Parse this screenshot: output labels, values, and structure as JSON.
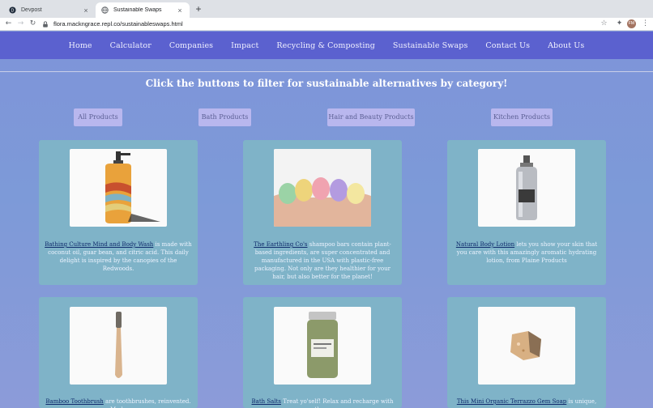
{
  "browser": {
    "tabs": [
      {
        "title": "Devpost",
        "active": false
      },
      {
        "title": "Sustainable Swaps",
        "active": true
      }
    ],
    "new_tab": "+",
    "close": "×",
    "url": "flora.mackngrace.repl.co/sustainableswaps.html",
    "avatar_initials": "FM"
  },
  "nav": {
    "links": [
      "Home",
      "Calculator",
      "Companies",
      "Impact",
      "Recycling & Composting",
      "Sustainable Swaps",
      "Contact Us",
      "About Us"
    ]
  },
  "headline": "Click the buttons to filter for sustainable alternatives by category!",
  "filters": [
    "All Products",
    "Bath Products",
    "Hair and Beauty Products",
    "Kitchen Products"
  ],
  "cards": [
    {
      "link": "Bathing Culture Mind and Body Wash",
      "text": " is made with coconut oil, guar bean, and citric acid. This daily delight is inspired by the canopies of the Redwoods.",
      "image": "soap-bottle"
    },
    {
      "link": "The Earthling Co's",
      "text": " shampoo bars contain plant-based ingredients, are super concentrated and manufactured in the USA with plastic-free packaging. Not only are they healthier for your hair, but also better for the planet!",
      "image": "shampoo-bars"
    },
    {
      "link": "Natural Body Lotion",
      "text": " lets you show your skin that you care with this amazingly aromatic hydrating lotion, from Plaine Products",
      "image": "lotion-bottle"
    },
    {
      "link": "Bamboo Toothbrush",
      "text": " are toothbrushes, reinvented. Made",
      "image": "toothbrush"
    },
    {
      "link": "Bath Salts",
      "text": " Treat yo'self! Relax and recharge with these",
      "image": "bath-salts-jar"
    },
    {
      "link": "This Mini Organic Terrazzo Gem Soap",
      "text": " is unique,",
      "image": "gem-soap"
    }
  ],
  "colors": {
    "nav_bg": "#5b61cf",
    "page_bg": "#7f95d8",
    "card_bg": "#7fb3c8",
    "filter_bg": "#b9b7ee",
    "link": "#0f2a6b"
  }
}
